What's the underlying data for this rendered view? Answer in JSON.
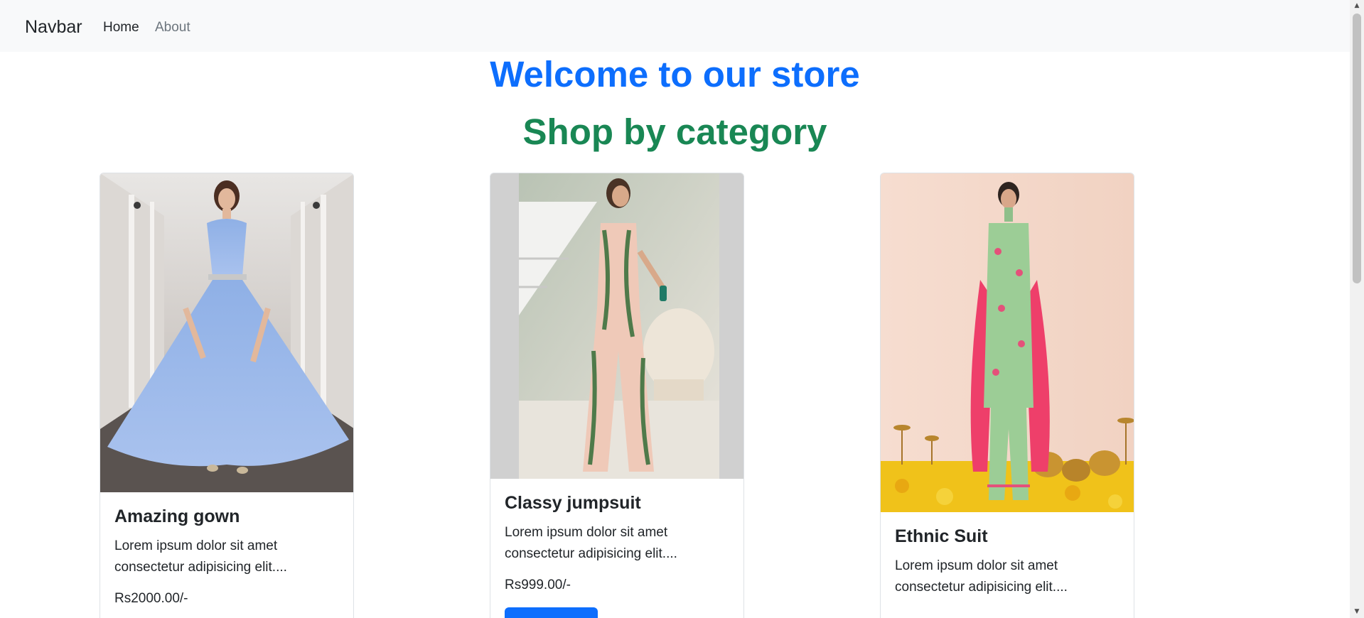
{
  "navbar": {
    "brand": "Navbar",
    "links": [
      {
        "label": "Home",
        "active": true
      },
      {
        "label": "About",
        "active": false
      }
    ]
  },
  "headings": {
    "welcome": "Welcome to our store",
    "category": "Shop by category"
  },
  "products": [
    {
      "title": "Amazing gown",
      "description": "Lorem ipsum dolor sit amet consectetur adipisicing elit....",
      "price": "Rs2000.00/-",
      "image": "blue-gown-photo"
    },
    {
      "title": "Classy jumpsuit",
      "description": "Lorem ipsum dolor sit amet consectetur adipisicing elit....",
      "price": "Rs999.00/-",
      "image": "printed-jumpsuit-photo"
    },
    {
      "title": "Ethnic Suit",
      "description": "Lorem ipsum dolor sit amet consectetur adipisicing elit....",
      "price": "",
      "image": "ethnic-suit-photo"
    }
  ],
  "colors": {
    "primary": "#0d6efd",
    "success": "#198754",
    "navbar_bg": "#f8f9fa"
  }
}
